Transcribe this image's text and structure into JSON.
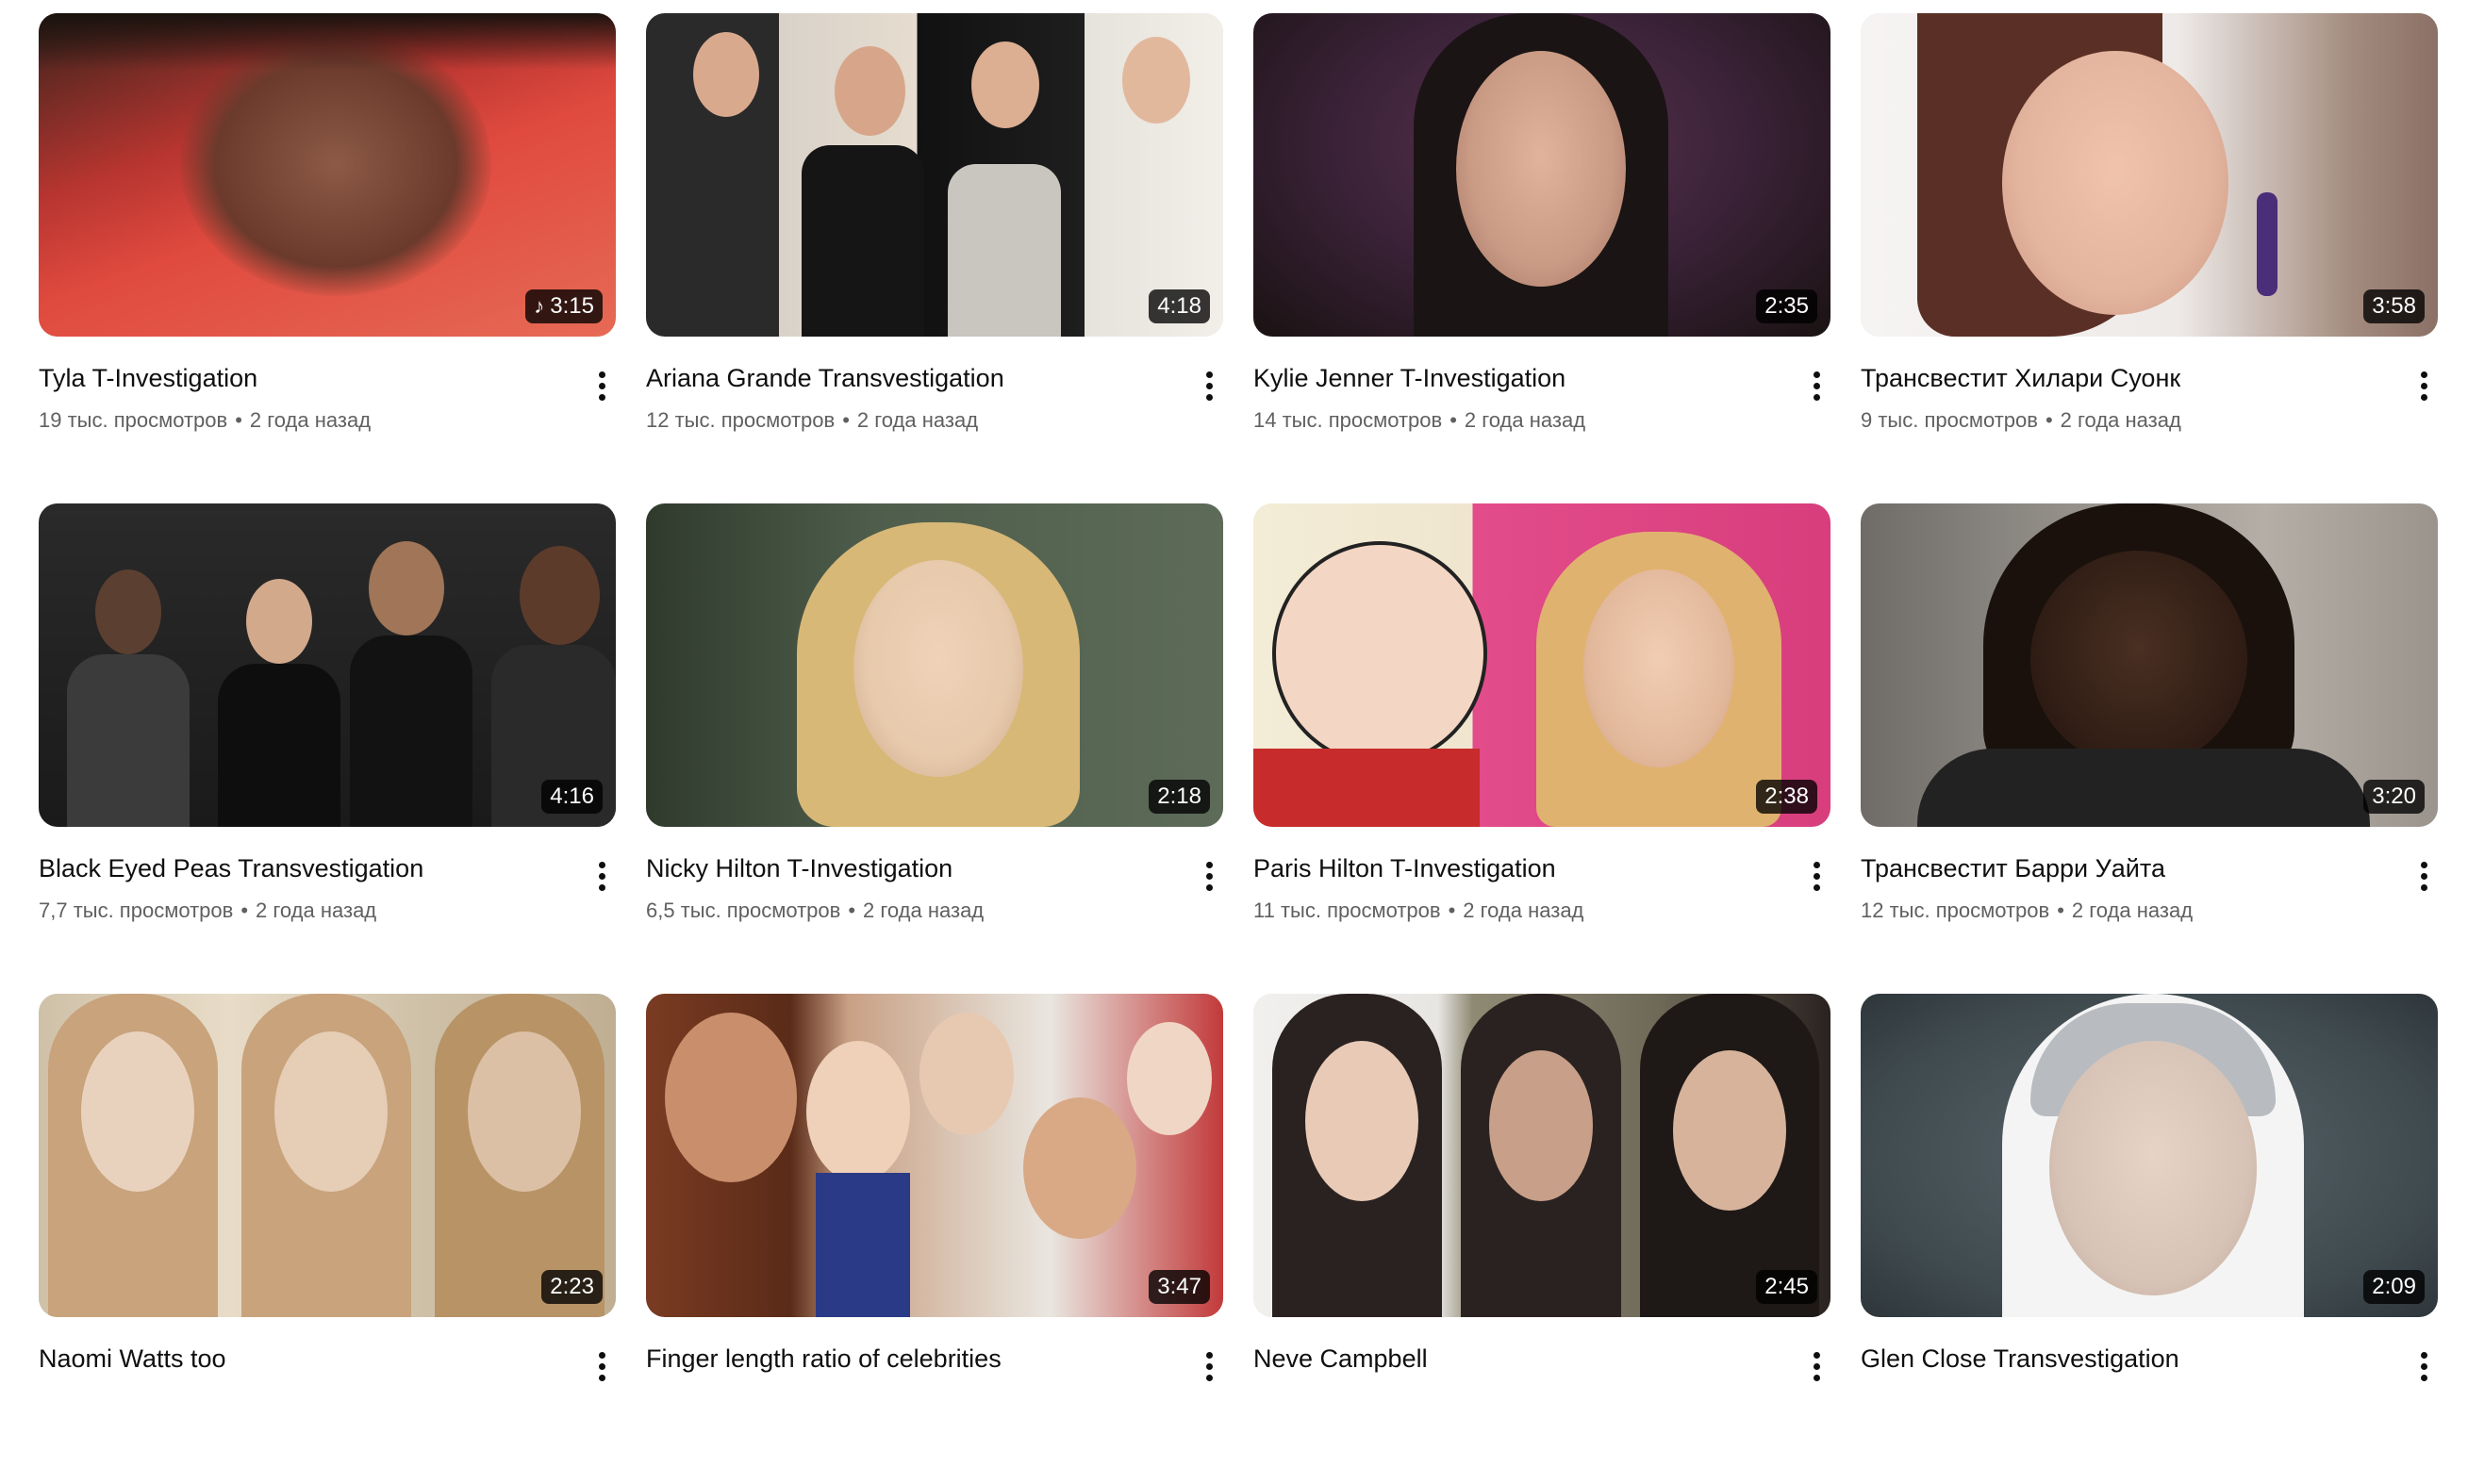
{
  "videos": [
    {
      "title": "Tyla T-Investigation",
      "views": "19 тыс. просмотров",
      "age": "2 года назад",
      "duration": "3:15",
      "icon": "music-note-icon",
      "palette": [
        "#e04a3f",
        "#b73530",
        "#6b3a2c",
        "#3a221b"
      ]
    },
    {
      "title": "Ariana Grande Transvestigation",
      "views": "12 тыс. просмотров",
      "age": "2 года назад",
      "duration": "4:18",
      "palette": [
        "#2a2a2a",
        "#d8cfc7",
        "#111111",
        "#e6e2dc"
      ]
    },
    {
      "title": "Kylie Jenner T-Investigation",
      "views": "14 тыс. просмотров",
      "age": "2 года назад",
      "duration": "2:35",
      "palette": [
        "#4a2a44",
        "#2b1a2a",
        "#c99a84",
        "#1a1212"
      ]
    },
    {
      "title": "Трансвестит Хилари Суонк",
      "views": "9 тыс. просмотров",
      "age": "2 года назад",
      "duration": "3:58",
      "palette": [
        "#f2efee",
        "#5a2f25",
        "#e3b49e",
        "#8b7165"
      ]
    },
    {
      "title": "Black Eyed Peas Transvestigation",
      "views": "7,7 тыс. просмотров",
      "age": "2 года назад",
      "duration": "4:16",
      "palette": [
        "#1c1c1c",
        "#3b3b3b",
        "#7a5b48",
        "#101010"
      ]
    },
    {
      "title": "Nicky Hilton T-Investigation",
      "views": "6,5 тыс. просмотров",
      "age": "2 года назад",
      "duration": "2:18",
      "palette": [
        "#4f5e4c",
        "#d7b877",
        "#e7c9ac",
        "#2f3a2c"
      ]
    },
    {
      "title": "Paris Hilton T-Investigation",
      "views": "11 тыс. просмотров",
      "age": "2 года назад",
      "duration": "2:38",
      "palette": [
        "#f3d6c3",
        "#e24c8a",
        "#e0b26f",
        "#c72b2b"
      ]
    },
    {
      "title": "Трансвестит Барри Уайта",
      "views": "12 тыс. просмотров",
      "age": "2 года назад",
      "duration": "3:20",
      "palette": [
        "#6f6b66",
        "#2e1c14",
        "#b5aea6",
        "#1a110c"
      ]
    },
    {
      "title": "Naomi Watts too",
      "views": "",
      "age": "",
      "duration": "2:23",
      "palette": [
        "#cfc1a8",
        "#c8a37c",
        "#8a7560",
        "#e8dcc8"
      ]
    },
    {
      "title": "Finger length ratio of celebrities",
      "views": "",
      "age": "",
      "duration": "3:47",
      "palette": [
        "#7a3b22",
        "#c9a084",
        "#2a3a86",
        "#e9e6e0"
      ]
    },
    {
      "title": "Neve Campbell",
      "views": "",
      "age": "",
      "duration": "2:45",
      "palette": [
        "#f2f0ee",
        "#2a2220",
        "#c89f88",
        "#8e8a74"
      ]
    },
    {
      "title": "Glen Close Transvestigation",
      "views": "",
      "age": "",
      "duration": "2:09",
      "palette": [
        "#3f4a4f",
        "#f4f4f4",
        "#d7c3b6",
        "#b8bcc0"
      ]
    }
  ],
  "more_icon": "more-vertical-icon"
}
